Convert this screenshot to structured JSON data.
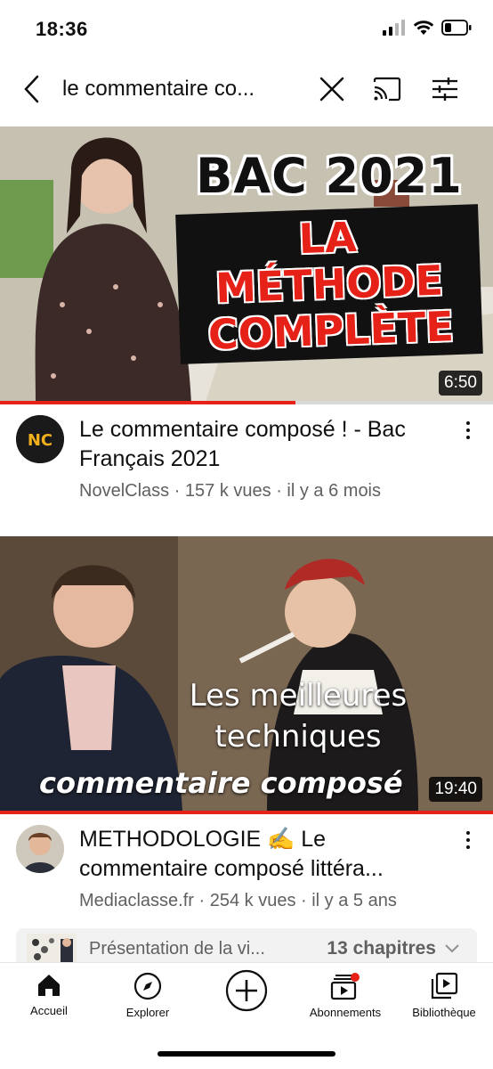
{
  "status_bar": {
    "time": "18:36"
  },
  "search": {
    "query": "le commentaire co..."
  },
  "videos": [
    {
      "thumb_text": {
        "line1": "BAC 2021",
        "line2": "LA MÉTHODE",
        "line3": "COMPLÈTE"
      },
      "duration": "6:50",
      "progress": 0.6,
      "avatar_text": "NC",
      "title": "Le commentaire composé ! - Bac Français 2021",
      "meta": "NovelClass · 157 k vues · il y a 6 mois"
    },
    {
      "thumb_text": {
        "line1": "Les meilleures",
        "line2": "techniques",
        "line3": "commentaire composé"
      },
      "duration": "19:40",
      "progress": 1.0,
      "title": "METHODOLOGIE ✍️ Le commentaire composé littéra...",
      "meta": "Mediaclasse.fr · 254 k vues · il y a 5 ans",
      "chapters": {
        "preview": "Présentation de la vi...",
        "count": "13 chapitres"
      }
    }
  ],
  "bottom_nav": {
    "items": [
      {
        "label": "Accueil",
        "icon": "home-icon"
      },
      {
        "label": "Explorer",
        "icon": "explore-icon"
      },
      {
        "label": "",
        "icon": "create-icon"
      },
      {
        "label": "Abonnements",
        "icon": "subscriptions-icon"
      },
      {
        "label": "Bibliothèque",
        "icon": "library-icon"
      }
    ]
  },
  "colors": {
    "accent_red": "#e62117",
    "meta_gray": "#606060",
    "text": "#0f0f0f"
  }
}
